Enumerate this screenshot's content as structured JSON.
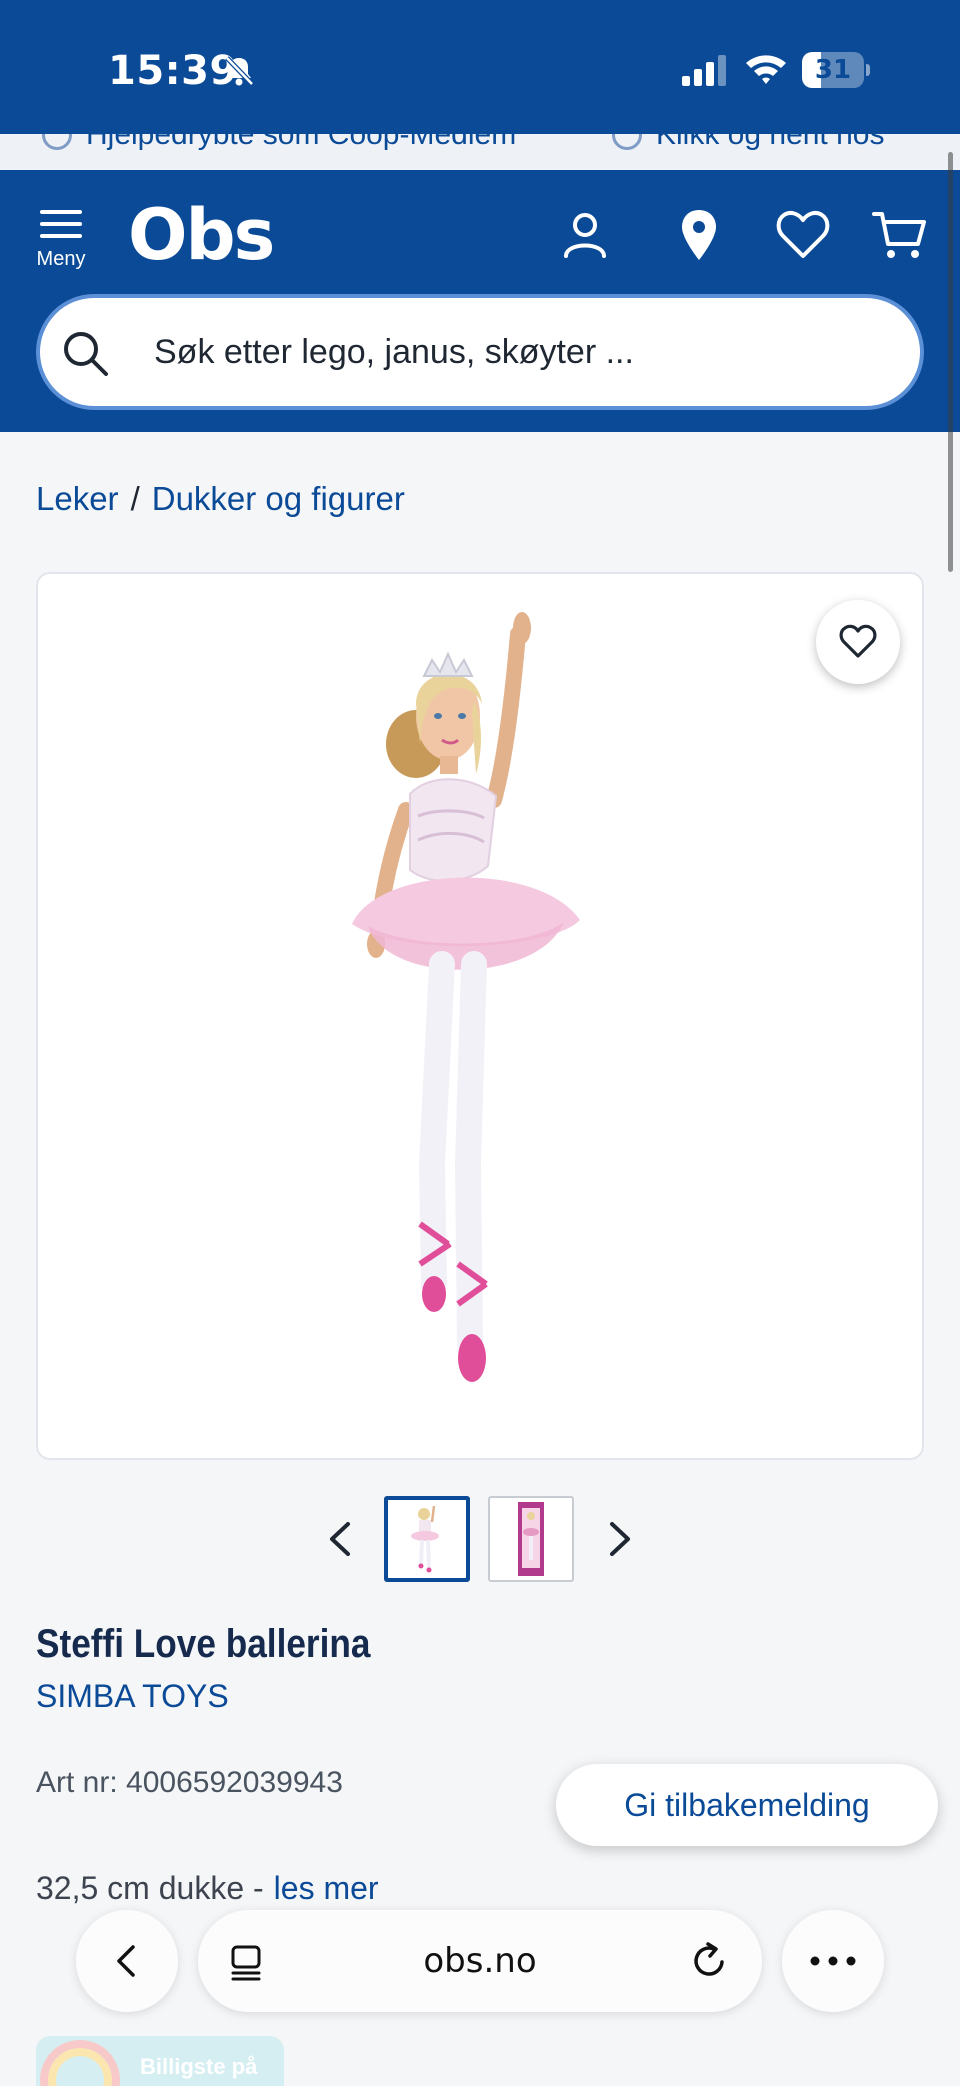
{
  "status_bar": {
    "time": "15:39",
    "battery": "31",
    "battery_level": 0.31
  },
  "promo": {
    "items": [
      "Hjelpedrybte som Coop-Medlem",
      "Klikk og hent hos"
    ]
  },
  "header": {
    "menu_label": "Meny",
    "logo": "Obs",
    "search_placeholder": "Søk etter lego, janus, skøyter ..."
  },
  "breadcrumb": {
    "items": [
      "Leker",
      "Dukker og figurer"
    ],
    "separator": "/"
  },
  "product": {
    "title": "Steffi Love ballerina",
    "brand": "SIMBA TOYS",
    "art_nr": "Art nr: 4006592039943",
    "description": "32,5 cm dukke -",
    "read_more": "les mer",
    "thumbnails": 2,
    "selected_thumbnail": 1
  },
  "feedback": {
    "label": "Gi tilbakemelding"
  },
  "browser": {
    "url": "obs.no"
  },
  "badge": {
    "label": "Billigste på"
  },
  "colors": {
    "brand_blue": "#0a4a97",
    "background": "#f5f6f8",
    "search_border": "#5b8fd6"
  }
}
